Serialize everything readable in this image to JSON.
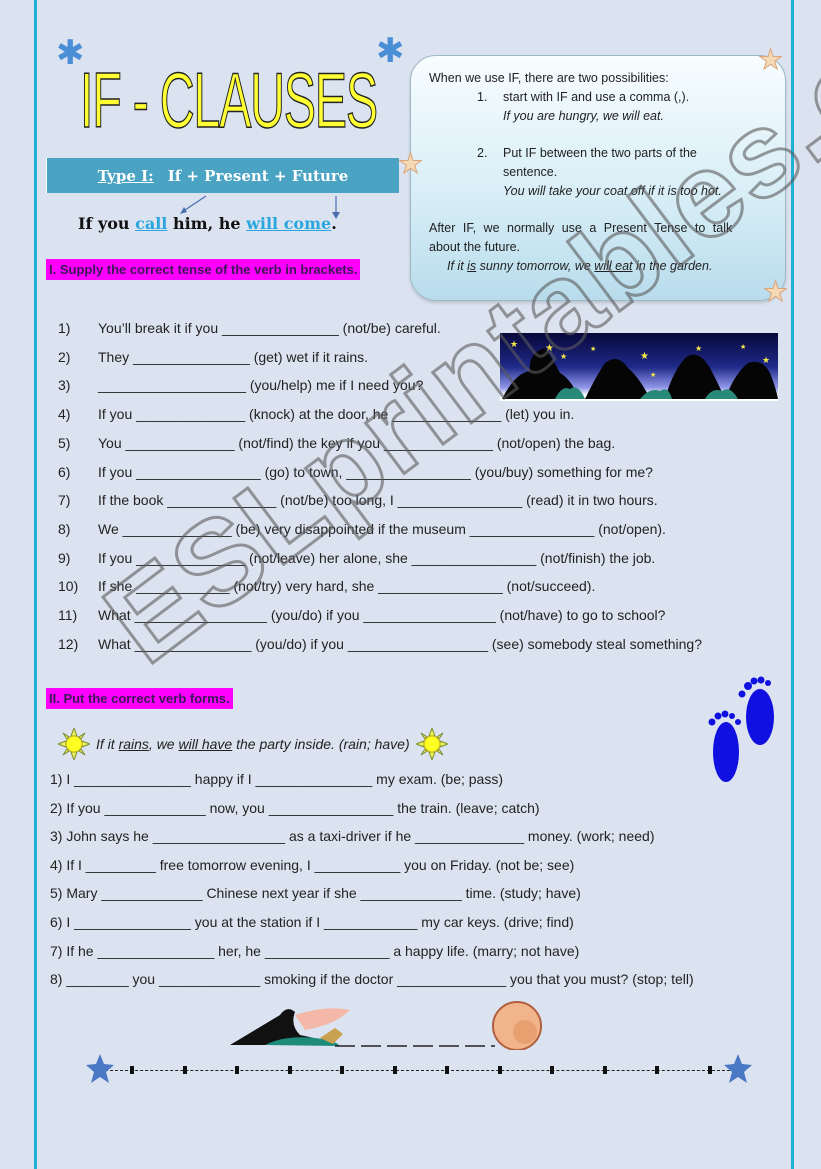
{
  "title": "IF - CLAUSES",
  "type_bar": {
    "label": "Type I:",
    "formula": "If + Present + Future"
  },
  "example_sentence": {
    "part1": "If you ",
    "verb1": "call",
    "part2": " him, he ",
    "verb2": "will come",
    "part3": "."
  },
  "note_box": {
    "intro": "When we use IF, there are two possibilities:",
    "point1_num": "1.",
    "point1": "start with  IF and use a comma (,).",
    "point1_example": "If you are hungry, we will eat.",
    "point2_num": "2.",
    "point2_line1": "Put IF between the two parts of the",
    "point2_line2": "sentence.",
    "point2_example": "You will take your coat off if it is too hot.",
    "after_line1": "After IF, we normally use a Present Tense to talk",
    "after_line2": "about the future.",
    "final_pre": "If it ",
    "final_is": "is",
    "final_mid": " sunny tomorrow, we ",
    "final_will": "will eat",
    "final_post": " in the garden."
  },
  "section1": {
    "heading": "I. Supply the correct tense of the verb in brackets.",
    "items": [
      {
        "num": "1)",
        "text": "You’ll break it if you _______________ (not/be) careful."
      },
      {
        "num": "2)",
        "text": "They _______________ (get) wet if it rains."
      },
      {
        "num": "3)",
        "text": "___________________ (you/help) me if I need you?"
      },
      {
        "num": "4)",
        "text": "If you ______________ (knock) at the door, he ______________ (let) you in."
      },
      {
        "num": "5)",
        "text": "You ______________ (not/find) the key if you ______________ (not/open) the bag."
      },
      {
        "num": "6)",
        "text": "If you ________________ (go) to town, ________________ (you/buy) something for me?"
      },
      {
        "num": "7)",
        "text": "If the book ______________ (not/be) too long, I ________________ (read) it in two hours."
      },
      {
        "num": "8)",
        "text": "We ______________ (be) very disappointed if the museum ________________ (not/open)."
      },
      {
        "num": "9)",
        "text": "If you ______________ (not/leave) her alone, she ________________ (not/finish) the job."
      },
      {
        "num": "10)",
        "text": "If she ____________ (not/try) very hard, she ________________ (not/succeed)."
      },
      {
        "num": "11)",
        "text": "What _________________ (you/do) if you _________________ (not/have) to go to school?"
      },
      {
        "num": "12)",
        "text": "What _______________ (you/do) if you __________________ (see) somebody steal something?"
      }
    ]
  },
  "section2": {
    "heading": "II. Put the correct verb forms.",
    "sample_pre": "If it ",
    "sample_rains": "rains",
    "sample_mid": ", we ",
    "sample_will": "will have",
    "sample_post": " the party inside. (rain; have)",
    "items": [
      "1) I _______________ happy if I _______________ my exam. (be; pass)",
      "2) If you _____________ now, you ________________ the train. (leave; catch)",
      "3) John says he _________________ as a taxi-driver if he ______________ money. (work; need)",
      "4) If I _________ free tomorrow evening, I ___________ you on Friday. (not be; see)",
      "5) Mary _____________ Chinese next year if she _____________ time. (study; have)",
      "6) I _______________ you at the station if I ____________ my car keys. (drive; find)",
      "7) If he _______________ her, he ________________ a happy life. (marry; not have)",
      "8) ________ you _____________ smoking if the doctor ______________ you that you must? (stop; tell)"
    ]
  },
  "watermark": "ESLprintables.com",
  "colors": {
    "background": "#dbe3f0",
    "frame": "#1fb0d6",
    "heading_bg": "#ff00ff",
    "type_bar_bg": "#4ba3c3",
    "highlight_verb": "#2aa6de",
    "title_fill": "#ffff33"
  }
}
